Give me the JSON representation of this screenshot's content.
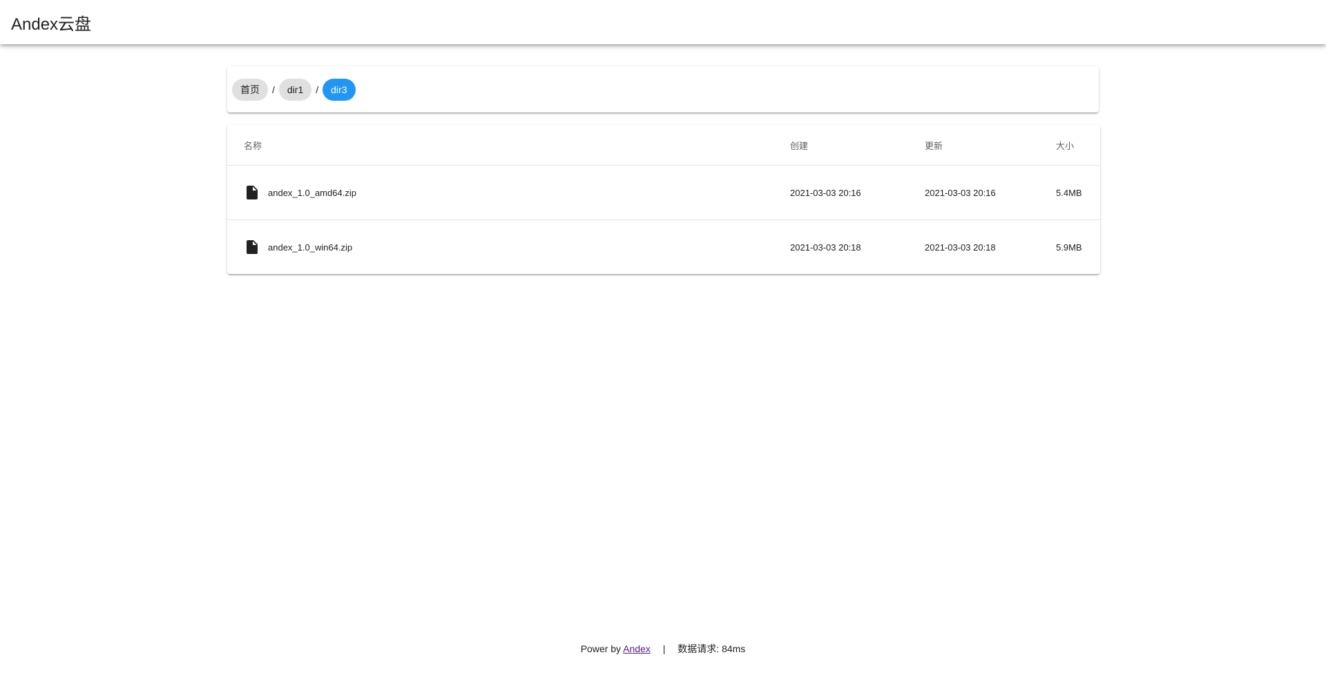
{
  "app": {
    "title": "Andex云盘"
  },
  "breadcrumb": {
    "separator": "/",
    "items": [
      {
        "label": "首页",
        "active": false
      },
      {
        "label": "dir1",
        "active": false
      },
      {
        "label": "dir3",
        "active": true
      }
    ]
  },
  "table": {
    "headers": {
      "name": "名称",
      "created": "创建",
      "updated": "更新",
      "size": "大小"
    },
    "rows": [
      {
        "icon": "file-icon",
        "name": "andex_1.0_amd64.zip",
        "created": "2021-03-03 20:16",
        "updated": "2021-03-03 20:16",
        "size": "5.4MB"
      },
      {
        "icon": "file-icon",
        "name": "andex_1.0_win64.zip",
        "created": "2021-03-03 20:18",
        "updated": "2021-03-03 20:18",
        "size": "5.9MB"
      }
    ]
  },
  "footer": {
    "power_by": "Power by",
    "link_text": "Andex",
    "separator": "|",
    "request_label": "数据请求: 84ms"
  },
  "colors": {
    "accent": "#2196f3",
    "chip": "#e0e0e0",
    "link": "#551a8b"
  }
}
